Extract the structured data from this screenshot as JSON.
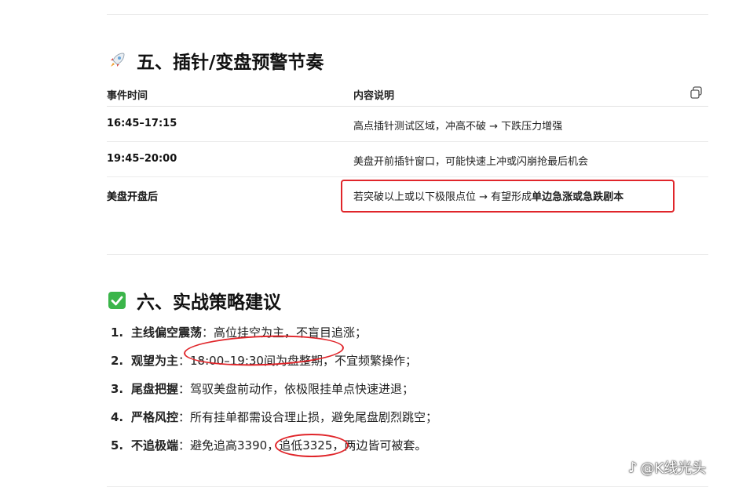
{
  "section5": {
    "emoji": "rocket-icon",
    "title": "五、插针/变盘预警节奏",
    "table": {
      "headers": [
        "事件时间",
        "内容说明"
      ],
      "rows": [
        {
          "time": "16:45–17:15",
          "desc": "高点插针测试区域，冲高不破 → 下跌压力增强"
        },
        {
          "time": "19:45–20:00",
          "desc": "美盘开前插针窗口，可能快速上冲或闪崩抢最后机会"
        },
        {
          "time": "美盘开盘后",
          "desc": "若突破以上或以下极限点位 → 有望形成",
          "desc_bold": "单边急涨或急跌剧本"
        }
      ]
    }
  },
  "section6": {
    "emoji": "check-icon",
    "title": "六、实战策略建议",
    "items": [
      {
        "num": "1.",
        "kw": "主线偏空震荡",
        "text": "：高位挂空为主，不盲目追涨；"
      },
      {
        "num": "2.",
        "kw": "观望为主",
        "text": "：18:00–19:30间为盘整期，不宜频繁操作；"
      },
      {
        "num": "3.",
        "kw": "尾盘把握",
        "text": "：驾驭美盘前动作，依极限挂单点快速进退；"
      },
      {
        "num": "4.",
        "kw": "严格风控",
        "text": "：所有挂单都需设合理止损，避免尾盘剧烈跳空；"
      },
      {
        "num": "5.",
        "kw": "不追极端",
        "text": "：避免追高3390，追低3325，两边皆可被套。"
      }
    ]
  },
  "watermark": "@K线光头",
  "colors": {
    "annotation_red": "#e0252a",
    "check_green": "#3bb54a"
  }
}
